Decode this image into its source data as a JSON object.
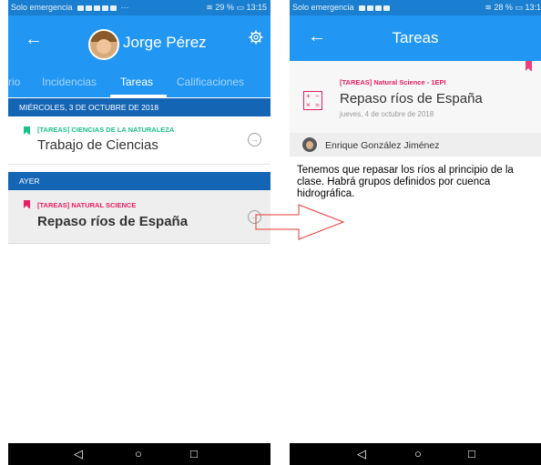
{
  "colors": {
    "primary": "#2196f3",
    "primary_dark": "#1565b5",
    "status_bar": "#1a7fd0",
    "green_tag": "#1cc08a",
    "pink_tag": "#e91e63",
    "callout_arrow": "#e53935"
  },
  "left_screen": {
    "status_bar": {
      "carrier": "Solo emergencia",
      "extra": "···",
      "battery": "29 %",
      "time": "13:15"
    },
    "header": {
      "user_name": "Jorge Pérez",
      "back_icon": "arrow-left-icon",
      "settings_icon": "gear-icon"
    },
    "tabs": [
      {
        "label": "rio"
      },
      {
        "label": "Incidencias"
      },
      {
        "label": "Tareas",
        "active": true
      },
      {
        "label": "Calificaciones"
      }
    ],
    "sections": [
      {
        "header": "MIÉRCOLES, 3 DE OCTUBRE DE 2018",
        "items": [
          {
            "tag": "[TAREAS] CIENCIAS DE LA NATURALEZA",
            "title": "Trabajo de Ciencias",
            "tag_color": "#1cc08a"
          }
        ]
      },
      {
        "header": "AYER",
        "items": [
          {
            "tag": "[TAREAS] NATURAL SCIENCE",
            "title": "Repaso ríos de España",
            "tag_color": "#e91e63"
          }
        ]
      }
    ],
    "nav_bar": {
      "back": "◁",
      "home": "○",
      "recents": "□"
    }
  },
  "right_screen": {
    "status_bar": {
      "carrier": "Solo emergencia",
      "battery": "28 %",
      "time": "13:1"
    },
    "header": {
      "title": "Tareas"
    },
    "detail": {
      "tag": "[TAREAS] Natural Science - 1EPI",
      "title": "Repaso ríos de España",
      "date": "jueves, 4 de octubre de 2018",
      "subject_icon": "calculator-icon"
    },
    "author": {
      "name": "Enrique González Jiménez"
    },
    "body": "Tenemos que repasar los ríos al principio de la clase. Habrá grupos definidos por cuenca hidrográfica.",
    "nav_bar": {
      "back": "◁",
      "home": "○",
      "recents": "□"
    }
  }
}
